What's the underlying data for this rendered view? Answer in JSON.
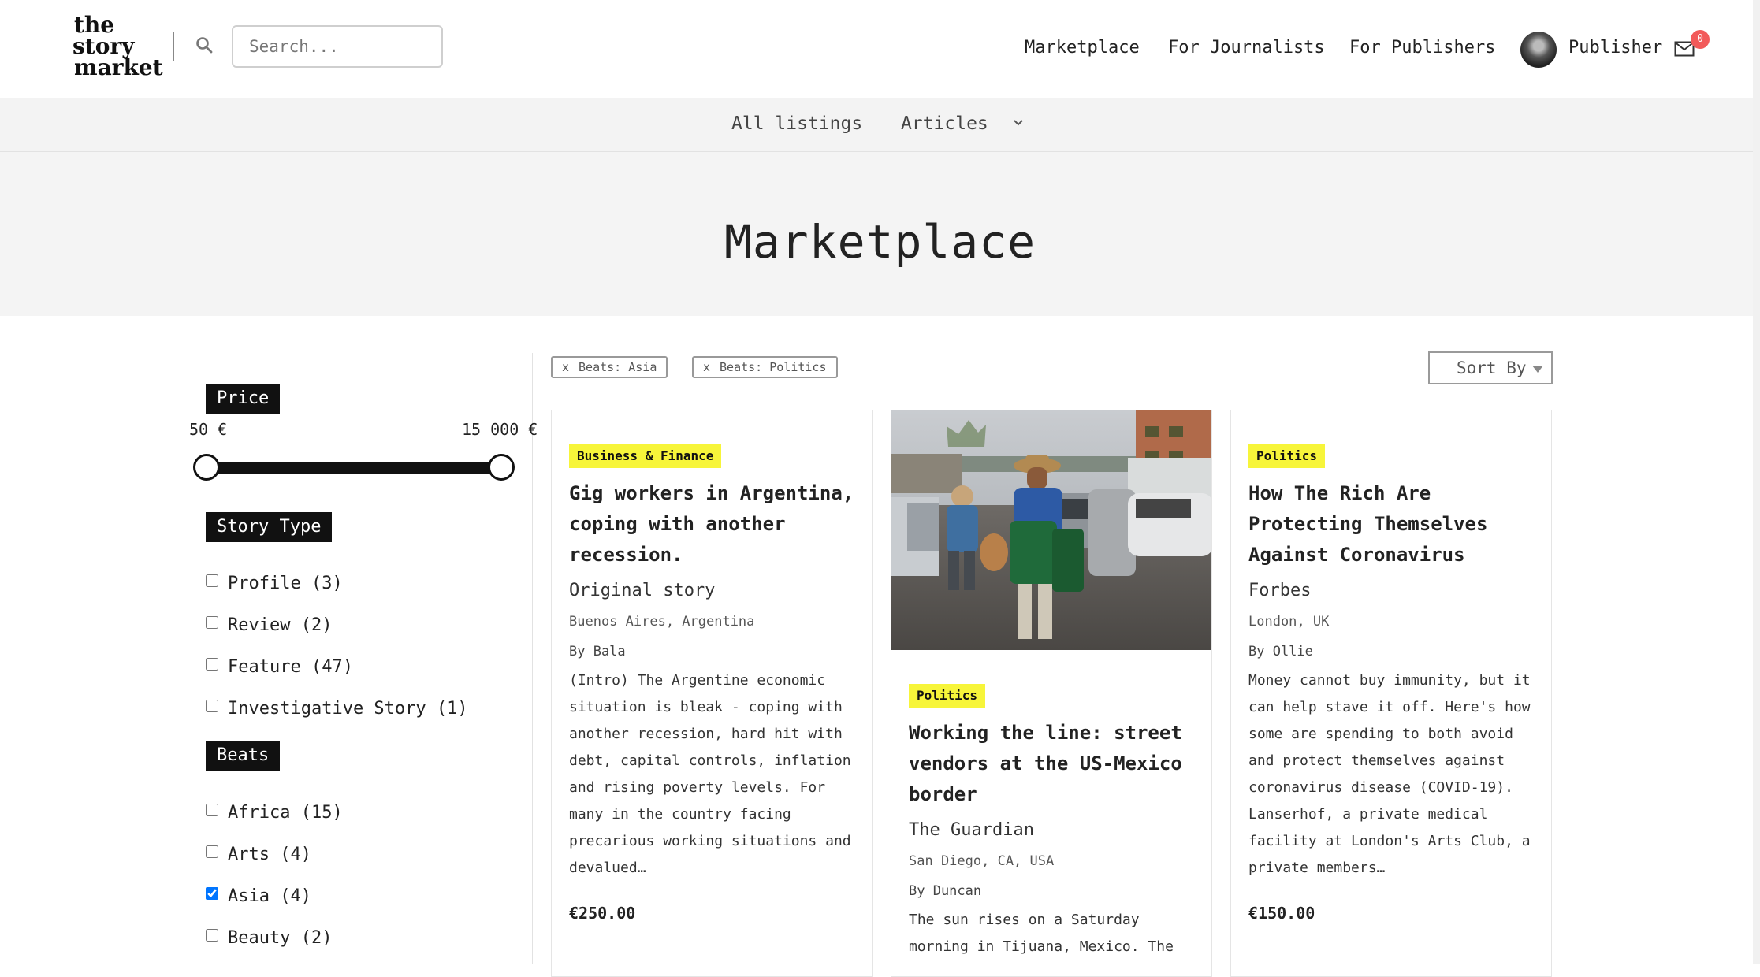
{
  "header": {
    "logo": {
      "line1": "the",
      "line2": "story",
      "line3": "market"
    },
    "search_placeholder": "Search...",
    "nav": [
      "Marketplace",
      "For Journalists",
      "For Publishers"
    ],
    "user_label": "Publisher",
    "mail_count": "0"
  },
  "subnav": {
    "all_listings": "All listings",
    "articles": "Articles"
  },
  "page_title": "Marketplace",
  "sidebar": {
    "price": {
      "label": "Price",
      "min_label": "50 €",
      "max_label": "15 000 €"
    },
    "story_type": {
      "label": "Story Type",
      "items": [
        {
          "label": "Profile (3)",
          "checked": false
        },
        {
          "label": "Review (2)",
          "checked": false
        },
        {
          "label": "Feature (47)",
          "checked": false
        },
        {
          "label": "Investigative Story (1)",
          "checked": false
        }
      ]
    },
    "beats": {
      "label": "Beats",
      "items": [
        {
          "label": "Africa (15)",
          "checked": false
        },
        {
          "label": "Arts (4)",
          "checked": false
        },
        {
          "label": "Asia (4)",
          "checked": true
        },
        {
          "label": "Beauty (2)",
          "checked": false
        }
      ]
    }
  },
  "filters": {
    "chips": [
      {
        "x": "x",
        "label": "Beats: Asia"
      },
      {
        "x": "x",
        "label": "Beats: Politics"
      }
    ],
    "sort_label": "Sort By"
  },
  "cards": [
    {
      "category": "Business & Finance",
      "title": "Gig workers in Argentina, coping with another recession.",
      "source": "Original story",
      "location": "Buenos Aires, Argentina",
      "byline": "By Bala",
      "description": "(Intro) The Argentine economic situation is bleak - coping with another recession, hard hit with debt, capital controls, inflation and rising poverty levels. For many in the country facing precarious working situations and devalued…",
      "price": "€250.00"
    },
    {
      "category": "Politics",
      "title": "Working the line: street vendors at the US-Mexico border",
      "source": "The Guardian",
      "location": "San Diego, CA, USA",
      "byline": "By Duncan",
      "description": "The sun rises on a Saturday morning in Tijuana, Mexico. The"
    },
    {
      "category": "Politics",
      "title": "How The Rich Are Protecting Themselves Against Coronavirus",
      "source": "Forbes",
      "location": "London, UK",
      "byline": "By Ollie",
      "description": "Money cannot buy immunity, but it can help stave it off. Here's how some are spending to both avoid and protect themselves against coronavirus disease (COVID-19). Lanserhof, a private medical facility at London's Arts Club, a private members…",
      "price": "€150.00"
    }
  ]
}
